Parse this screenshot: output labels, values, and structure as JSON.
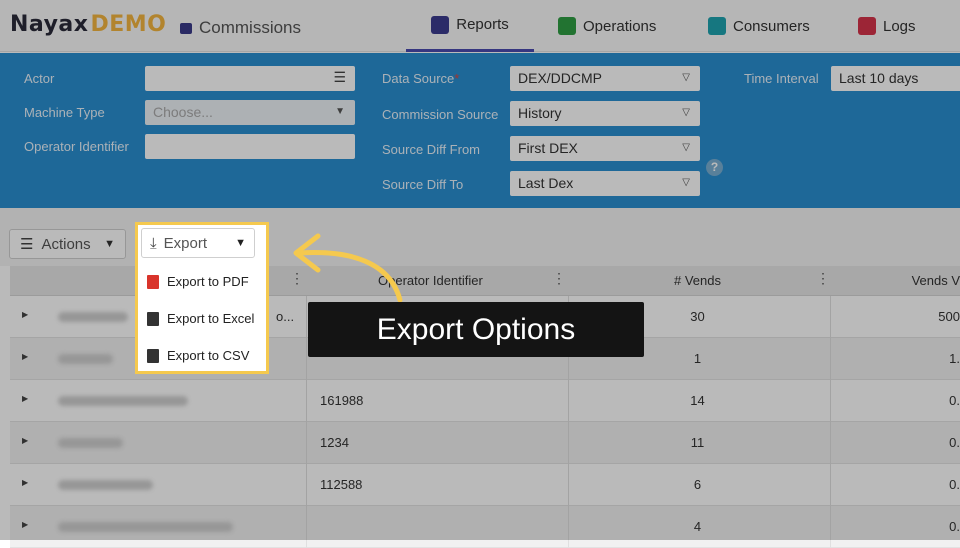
{
  "header": {
    "logo": {
      "brand": "Nayax",
      "suffix": "DEMO"
    },
    "module": {
      "label": "Commissions",
      "icon": "commissions-icon"
    },
    "nav": [
      {
        "label": "Reports",
        "icon": "reports-icon",
        "color": "#3b3b8f",
        "active": true
      },
      {
        "label": "Operations",
        "icon": "operations-icon",
        "color": "#2f9e44",
        "active": false
      },
      {
        "label": "Consumers",
        "icon": "consumers-icon",
        "color": "#1fa3b0",
        "active": false
      },
      {
        "label": "Logs",
        "icon": "logs-icon",
        "color": "#d6334a",
        "active": false
      }
    ]
  },
  "filters": {
    "actor": {
      "label": "Actor",
      "value": ""
    },
    "machine_type": {
      "label": "Machine Type",
      "placeholder": "Choose..."
    },
    "operator_identifier": {
      "label": "Operator Identifier",
      "value": ""
    },
    "data_source": {
      "label": "Data Source",
      "required_mark": "*",
      "value": "DEX/DDCMP"
    },
    "commission_source": {
      "label": "Commission Source",
      "value": "History"
    },
    "source_diff_from": {
      "label": "Source Diff From",
      "value": "First DEX"
    },
    "source_diff_to": {
      "label": "Source Diff To",
      "value": "Last Dex"
    },
    "time_interval": {
      "label": "Time Interval",
      "value": "Last 10 days"
    }
  },
  "toolbar": {
    "actions_label": "Actions",
    "export_label": "Export"
  },
  "export_menu": [
    {
      "label": "Export to PDF",
      "icon": "pdf-icon",
      "color": "#d9342b"
    },
    {
      "label": "Export to Excel",
      "icon": "excel-icon",
      "color": "#333333"
    },
    {
      "label": "Export to CSV",
      "icon": "csv-icon",
      "color": "#333333"
    }
  ],
  "table": {
    "columns": {
      "operator_identifier": "Operator Identifier",
      "vends": "# Vends",
      "vends_value": "Vends V"
    },
    "first_row_op_prefix": "o...",
    "rows": [
      {
        "operator_identifier": "",
        "vends": "30",
        "vends_value": "500"
      },
      {
        "operator_identifier": "",
        "vends": "1",
        "vends_value": "1."
      },
      {
        "operator_identifier": "161988",
        "vends": "14",
        "vends_value": "0."
      },
      {
        "operator_identifier": "1234",
        "vends": "11",
        "vends_value": "0."
      },
      {
        "operator_identifier": "112588",
        "vends": "6",
        "vends_value": "0."
      },
      {
        "operator_identifier": "",
        "vends": "4",
        "vends_value": "0."
      }
    ]
  },
  "callout": {
    "text": "Export Options",
    "color": "#f5c94e"
  }
}
